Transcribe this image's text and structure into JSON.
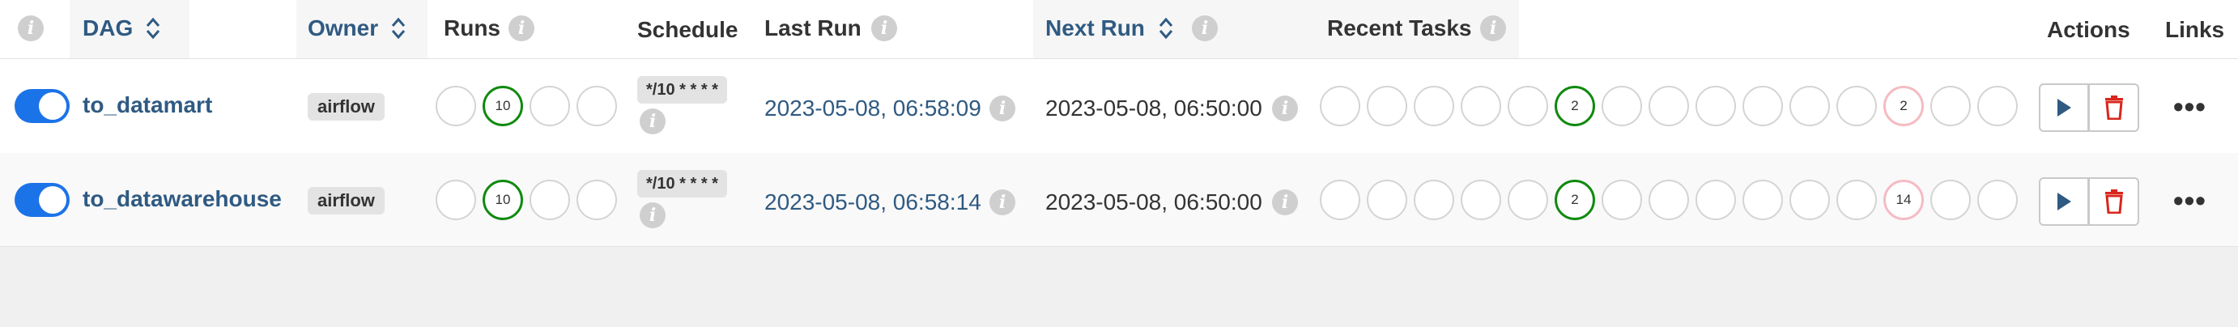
{
  "header": {
    "dag": "DAG",
    "owner": "Owner",
    "runs": "Runs",
    "schedule": "Schedule",
    "last_run": "Last Run",
    "next_run": "Next Run",
    "recent_tasks": "Recent Tasks",
    "actions": "Actions",
    "links": "Links",
    "info_glyph": "i"
  },
  "rows": [
    {
      "enabled": true,
      "dag_id": "to_datamart",
      "owner": "airflow",
      "runs": [
        "",
        "10",
        "",
        ""
      ],
      "schedule": "*/10 * * * *",
      "last_run": "2023-05-08, 06:58:09",
      "next_run": "2023-05-08, 06:50:00",
      "recent_tasks": [
        "",
        "",
        "",
        "",
        "",
        "2",
        "",
        "",
        "",
        "",
        "",
        "",
        "2",
        "",
        ""
      ],
      "more": "•••"
    },
    {
      "enabled": true,
      "dag_id": "to_datawarehouse",
      "owner": "airflow",
      "runs": [
        "",
        "10",
        "",
        ""
      ],
      "schedule": "*/10 * * * *",
      "last_run": "2023-05-08, 06:58:14",
      "next_run": "2023-05-08, 06:50:00",
      "recent_tasks": [
        "",
        "",
        "",
        "",
        "",
        "2",
        "",
        "",
        "",
        "",
        "",
        "",
        "14",
        "",
        ""
      ],
      "more": "•••"
    }
  ],
  "colors": {
    "link": "#2f5a82",
    "success": "#108a10",
    "failed": "#f4bcc3",
    "toggle_on": "#1b73e8",
    "delete": "#d9261c"
  }
}
